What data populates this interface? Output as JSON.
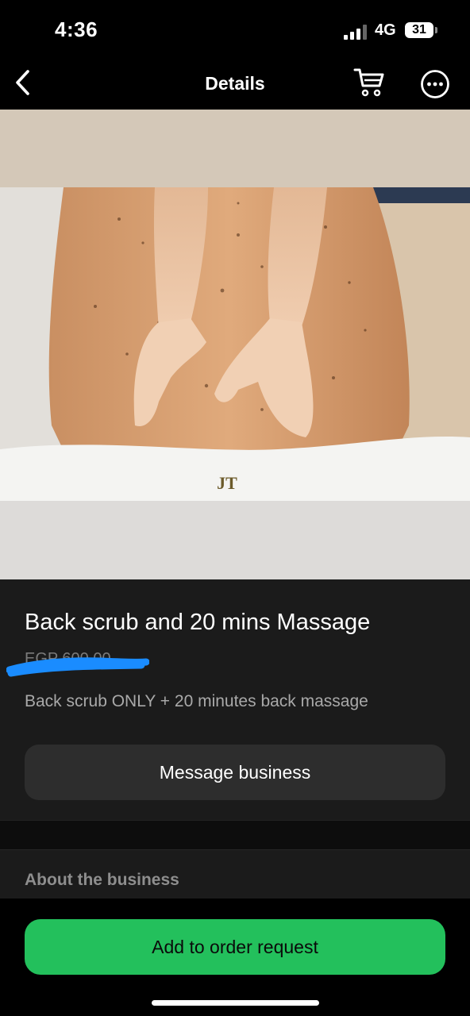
{
  "status_bar": {
    "time": "4:36",
    "network": "4G",
    "battery": "31"
  },
  "nav": {
    "title": "Details",
    "back_icon": "chevron-left-icon",
    "cart_icon": "cart-icon",
    "more_icon": "more-horizontal-icon"
  },
  "hero": {
    "logo_text": "JT"
  },
  "product": {
    "title": "Back scrub and 20 mins Massage",
    "price": "EGP 600.00",
    "description": "Back scrub ONLY + 20 minutes back massage"
  },
  "actions": {
    "message_label": "Message business",
    "order_label": "Add to order request"
  },
  "about": {
    "label": "About the business"
  },
  "colors": {
    "accent_green": "#23c05c",
    "redaction_blue": "#1a8cff",
    "background": "#1b1b1b"
  }
}
